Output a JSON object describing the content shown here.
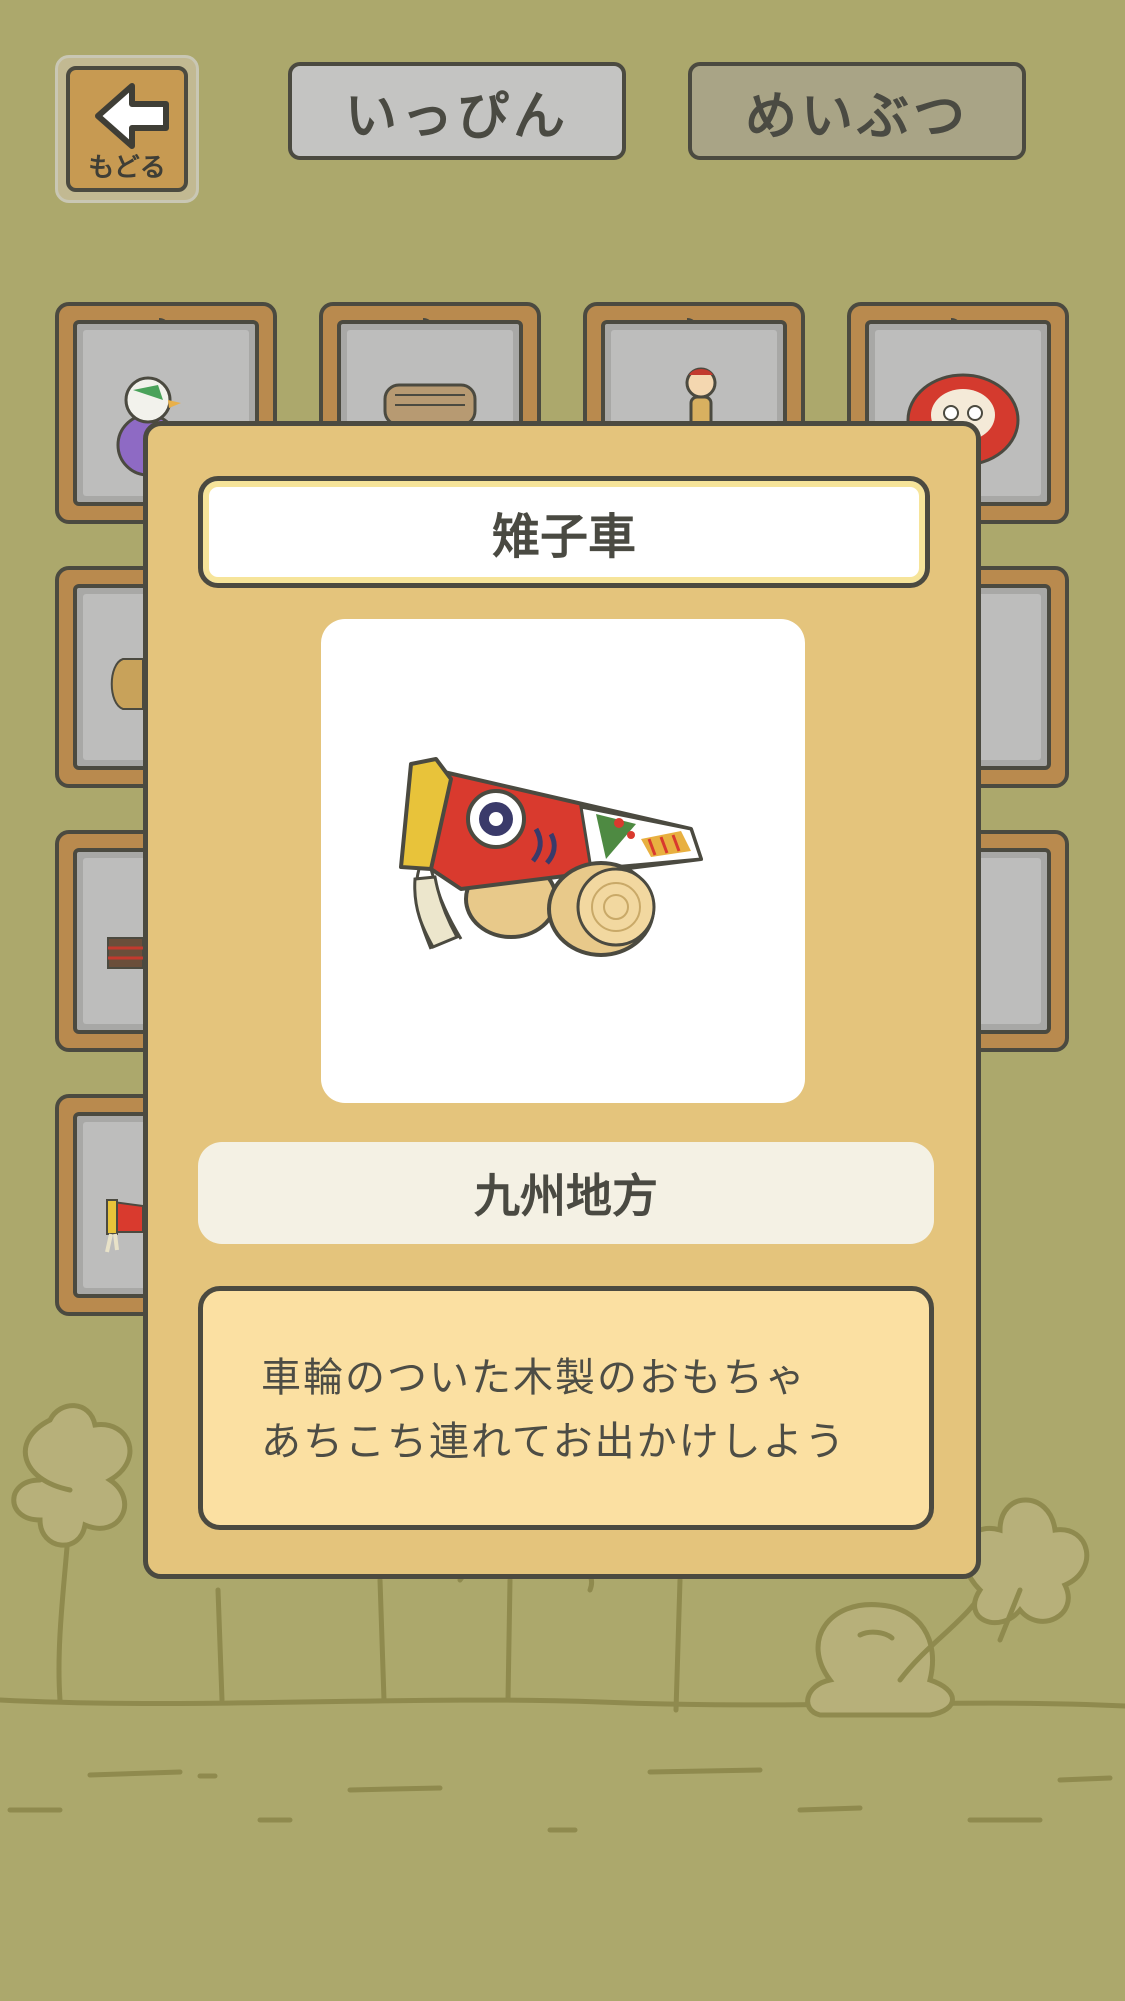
{
  "header": {
    "back_label": "もどる",
    "tabs": [
      {
        "label": "いっぴん"
      },
      {
        "label": "めいぶつ"
      }
    ]
  },
  "modal": {
    "title": "雉子車",
    "region": "九州地方",
    "description": [
      "車輪のついた木製のおもちゃ",
      "あちこち連れてお出かけしよう"
    ]
  },
  "colors": {
    "background": "#aca86c",
    "modal_bg": "#e4c47c",
    "card_frame": "#b98a4e",
    "outline": "#4b4a40",
    "description_bg": "#fbe0a2"
  }
}
